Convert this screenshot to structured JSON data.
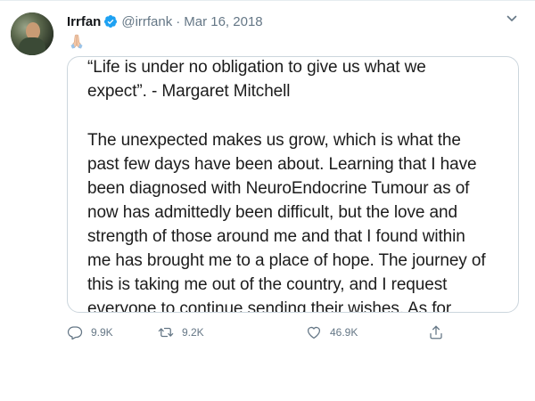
{
  "tweet": {
    "author": {
      "name": "Irrfan",
      "handle": "@irrfank",
      "separator": "·",
      "date": "Mar 16, 2018"
    },
    "emoji": "folded-hands-emoji",
    "card": {
      "quote_lines": [
        "“Life is under no obligation to give us what we",
        "expect”. - Margaret Mitchell"
      ],
      "body_lines": [
        "The unexpected makes us grow, which is what the",
        "past few days have been about. Learning that I have",
        "been diagnosed with NeuroEndocrine Tumour as of",
        "now has admittedly been difficult, but the love and",
        "strength of those around me and that I found within",
        "me has brought me to a place of hope. The journey of",
        "this is taking me out of the country, and I request",
        "everyone to continue sending their wishes. As for"
      ]
    },
    "actions": {
      "reply_count": "9.9K",
      "retweet_count": "9.2K",
      "like_count": "46.9K"
    }
  },
  "colors": {
    "verified": "#1da1f2",
    "secondary_text": "#657786",
    "border": "#ccd6dd"
  }
}
